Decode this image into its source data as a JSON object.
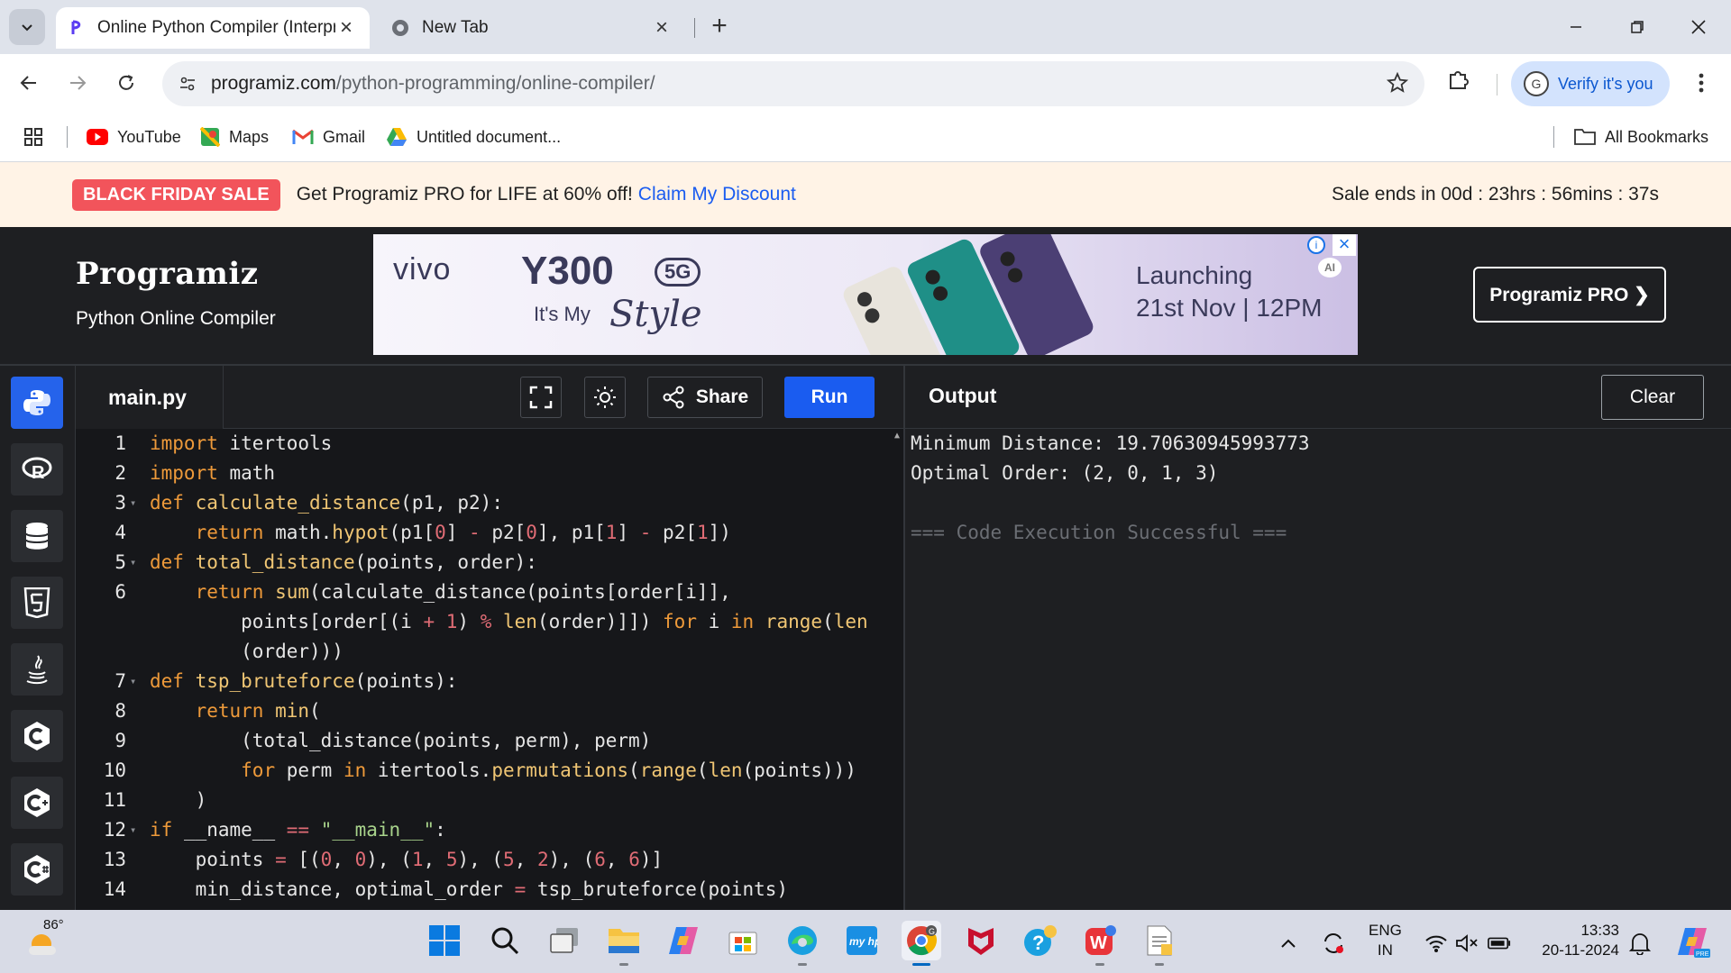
{
  "browser": {
    "tabs": [
      {
        "title": "Online Python Compiler (Interpreter)",
        "active": true
      },
      {
        "title": "New Tab",
        "active": false
      }
    ],
    "url": {
      "host": "programiz.com",
      "path": "/python-programming/online-compiler/"
    },
    "profile_label": "Verify it's you",
    "profile_initial": "G",
    "bookmarks": [
      {
        "label": "YouTube",
        "icon": "youtube-icon"
      },
      {
        "label": "Maps",
        "icon": "maps-icon"
      },
      {
        "label": "Gmail",
        "icon": "gmail-icon"
      },
      {
        "label": "Untitled document...",
        "icon": "drive-icon"
      }
    ],
    "all_bookmarks": "All Bookmarks"
  },
  "promo": {
    "badge": "BLACK FRIDAY SALE",
    "text": "Get Programiz PRO for LIFE at 60% off!",
    "link": "Claim My Discount",
    "timer": "Sale ends in 00d : 23hrs : 56mins : 37s"
  },
  "header": {
    "logo": "Programiz",
    "subtitle": "Python Online Compiler",
    "pro_button": "Programiz PRO ❯"
  },
  "ad": {
    "brand": "vivo",
    "model": "Y300",
    "network": "5G",
    "tagline": "It's My",
    "tagline_script": "Style",
    "launch_line1": "Launching",
    "launch_line2": "21st Nov | 12PM",
    "ai_badge": "AI"
  },
  "editor": {
    "filename": "main.py",
    "share_label": "Share",
    "run_label": "Run",
    "accent": "#1a5cf0",
    "languages": [
      "python-icon",
      "r-icon",
      "sql-icon",
      "html5-icon",
      "java-icon",
      "c-icon",
      "cpp-icon",
      "csharp-icon"
    ]
  },
  "output": {
    "title": "Output",
    "clear_label": "Clear",
    "lines": [
      "Minimum Distance: 19.70630945993773",
      "Optimal Order: (2, 0, 1, 3)",
      "",
      "=== Code Execution Successful ==="
    ]
  },
  "taskbar": {
    "temperature": "86°",
    "lang_top": "ENG",
    "lang_bottom": "IN",
    "time": "13:33",
    "date": "20-11-2024"
  }
}
